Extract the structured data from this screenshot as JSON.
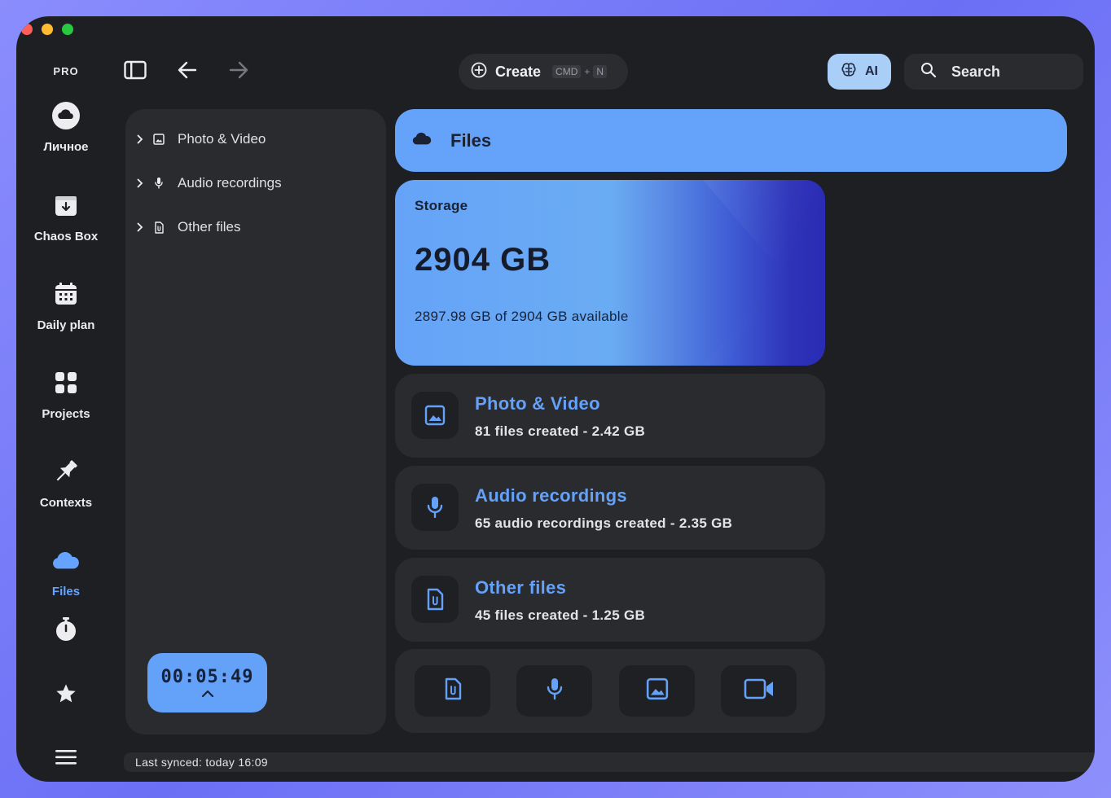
{
  "window": {
    "traffic_lights": [
      "close",
      "minimize",
      "zoom"
    ]
  },
  "sidebar": {
    "badge": "PRO",
    "items": [
      {
        "label": "Личное",
        "icon": "cloud-circle-icon"
      },
      {
        "label": "Chaos Box",
        "icon": "inbox-download-icon"
      },
      {
        "label": "Daily plan",
        "icon": "calendar-icon"
      },
      {
        "label": "Projects",
        "icon": "grid-icon"
      },
      {
        "label": "Contexts",
        "icon": "pin-icon"
      },
      {
        "label": "Files",
        "icon": "cloud-icon",
        "active": true
      }
    ],
    "extra_icons": [
      "stopwatch-icon",
      "star-icon",
      "menu-icon"
    ]
  },
  "toolbar": {
    "create_label": "Create",
    "shortcut_mod": "CMD",
    "shortcut_plus": "+",
    "shortcut_key": "N",
    "ai_label": "AI",
    "search_label": "Search"
  },
  "tree": {
    "items": [
      {
        "label": "Photo & Video",
        "icon": "image-icon"
      },
      {
        "label": "Audio recordings",
        "icon": "mic-icon"
      },
      {
        "label": "Other files",
        "icon": "file-clip-icon"
      }
    ],
    "timer": "00:05:49"
  },
  "header": {
    "title": "Files"
  },
  "storage": {
    "label": "Storage",
    "total": "2904 GB",
    "available": "2897.98 GB of 2904 GB available"
  },
  "categories": [
    {
      "title": "Photo & Video",
      "subtitle": "81 files created - 2.42 GB",
      "icon": "image-icon"
    },
    {
      "title": "Audio recordings",
      "subtitle": "65 audio recordings created - 2.35 GB",
      "icon": "mic-icon"
    },
    {
      "title": "Other files",
      "subtitle": "45 files created - 1.25 GB",
      "icon": "file-clip-icon"
    }
  ],
  "quick_add": [
    "file-clip-icon",
    "mic-icon",
    "image-icon",
    "video-icon"
  ],
  "status": {
    "text": "Last synced: today 16:09"
  },
  "colors": {
    "accent": "#64a1f9",
    "ai_button": "#a9cff8",
    "background": "#1e1f22",
    "panel": "#2a2b2f"
  }
}
